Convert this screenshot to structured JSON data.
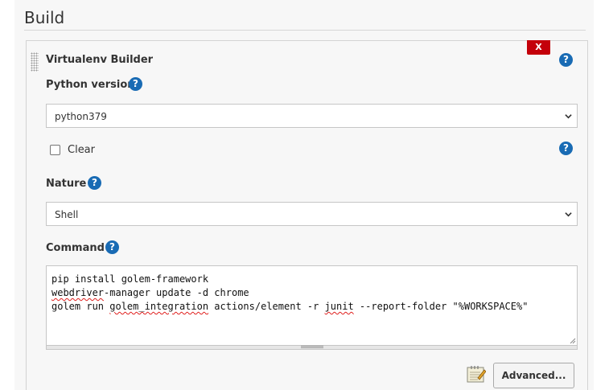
{
  "section": {
    "title": "Build"
  },
  "builder": {
    "title": "Virtualenv Builder",
    "delete_label": "X",
    "help_glyph": "?",
    "python_version": {
      "label": "Python version",
      "value": "python379"
    },
    "clear": {
      "label": "Clear",
      "checked": false
    },
    "nature": {
      "label": "Nature",
      "value": "Shell"
    },
    "command": {
      "label": "Command",
      "lines": [
        "pip install golem-framework",
        "webdriver-manager update -d chrome",
        "golem run golem_integration actions/element -r junit --report-folder \"%WORKSPACE%\""
      ]
    },
    "advanced_label": "Advanced..."
  },
  "colors": {
    "help_blue": "#196bb4",
    "delete_red": "#c4000a"
  },
  "icons": [
    "help-icon",
    "drag-handle-icon",
    "chevron-down-icon",
    "notepad-icon",
    "resize-grip-icon"
  ]
}
